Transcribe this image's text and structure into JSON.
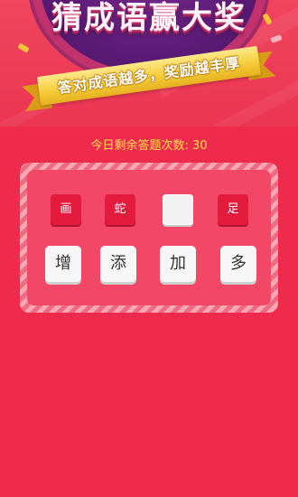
{
  "header": {
    "title": "猜成语赢大奖",
    "ribbon_text": "答对成语越多，奖励越丰厚"
  },
  "status": {
    "remaining_label": "今日剩余答题次数:",
    "remaining_count": "30"
  },
  "puzzle": {
    "slots": [
      {
        "char": "画",
        "filled": true
      },
      {
        "char": "蛇",
        "filled": true
      },
      {
        "char": "",
        "filled": false
      },
      {
        "char": "足",
        "filled": true
      }
    ],
    "choices": [
      "增",
      "添",
      "加",
      "多"
    ]
  },
  "colors": {
    "background": "#ee2b4c",
    "accent_gold": "#f5cc3a",
    "count_text": "#ffe14a",
    "slot_red": "#e31b3d"
  }
}
